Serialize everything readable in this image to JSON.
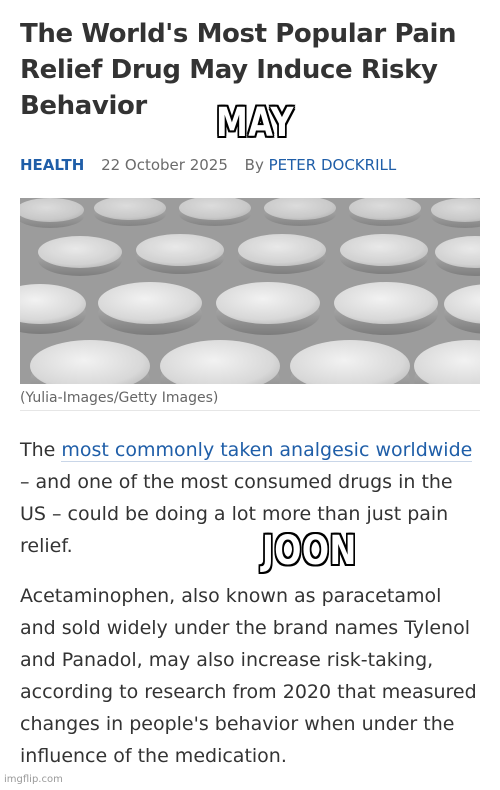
{
  "article": {
    "title": "The World's Most Popular Pain Relief Drug May Induce Risky Behavior",
    "category": "HEALTH",
    "date": "22 October 2025",
    "by_label": "By",
    "author": "PETER DOCKRILL",
    "image_credit": "(Yulia-Images/Getty Images)",
    "paragraph1": {
      "lead": "The ",
      "link": "most commonly taken analgesic worldwide",
      "rest": " – and one of the most consumed drugs in the US – could be doing a lot more than just pain relief."
    },
    "paragraph2": "Acetaminophen, also known as paracetamol and sold widely under the brand names Tylenol and Panadol, may also increase risk-taking, according to research from 2020 that measured changes in people's behavior when under the influence of the medication."
  },
  "meme": {
    "top_text": "MAY",
    "bottom_text": "JOON"
  },
  "watermark": "imgflip.com",
  "colors": {
    "link": "#1f5ea8",
    "text": "#333333",
    "muted": "#6b6b6b"
  }
}
